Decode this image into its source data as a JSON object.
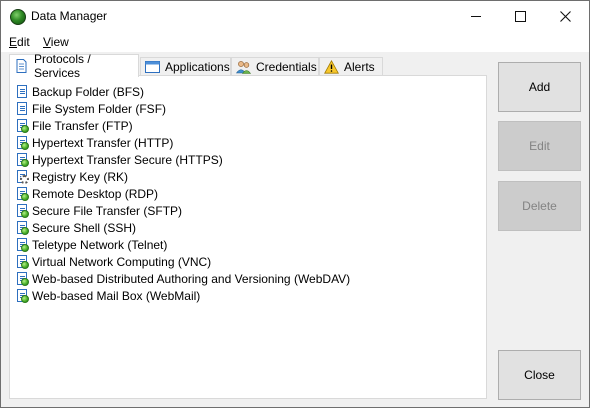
{
  "window": {
    "title": "Data Manager",
    "icon": "green-orb-icon"
  },
  "menu": {
    "edit": {
      "mnemonic": "E",
      "rest": "dit"
    },
    "view": {
      "mnemonic": "V",
      "rest": "iew"
    }
  },
  "tabs": [
    {
      "label": "Protocols / Services",
      "icon": "document-icon",
      "active": true
    },
    {
      "label": "Applications",
      "icon": "window-icon",
      "active": false
    },
    {
      "label": "Credentials",
      "icon": "users-icon",
      "active": false
    },
    {
      "label": "Alerts",
      "icon": "warning-icon",
      "active": false
    }
  ],
  "protocols": [
    {
      "label": "Backup Folder (BFS)",
      "icon": "document-icon"
    },
    {
      "label": "File System Folder (FSF)",
      "icon": "document-icon"
    },
    {
      "label": "File Transfer (FTP)",
      "icon": "network-document-icon"
    },
    {
      "label": "Hypertext Transfer (HTTP)",
      "icon": "network-document-icon"
    },
    {
      "label": "Hypertext Transfer Secure (HTTPS)",
      "icon": "network-document-icon"
    },
    {
      "label": "Registry Key (RK)",
      "icon": "registry-gear-icon"
    },
    {
      "label": "Remote Desktop (RDP)",
      "icon": "network-document-icon"
    },
    {
      "label": "Secure File Transfer (SFTP)",
      "icon": "network-document-icon"
    },
    {
      "label": "Secure Shell (SSH)",
      "icon": "network-document-icon"
    },
    {
      "label": "Teletype Network (Telnet)",
      "icon": "network-document-icon"
    },
    {
      "label": "Virtual Network Computing (VNC)",
      "icon": "network-document-icon"
    },
    {
      "label": "Web-based Distributed Authoring and Versioning (WebDAV)",
      "icon": "network-document-icon"
    },
    {
      "label": "Web-based Mail Box (WebMail)",
      "icon": "network-document-icon"
    }
  ],
  "buttons": {
    "add": {
      "label": "Add",
      "enabled": true
    },
    "edit": {
      "label": "Edit",
      "enabled": false
    },
    "delete": {
      "label": "Delete",
      "enabled": false
    },
    "close": {
      "label": "Close",
      "enabled": true
    }
  }
}
